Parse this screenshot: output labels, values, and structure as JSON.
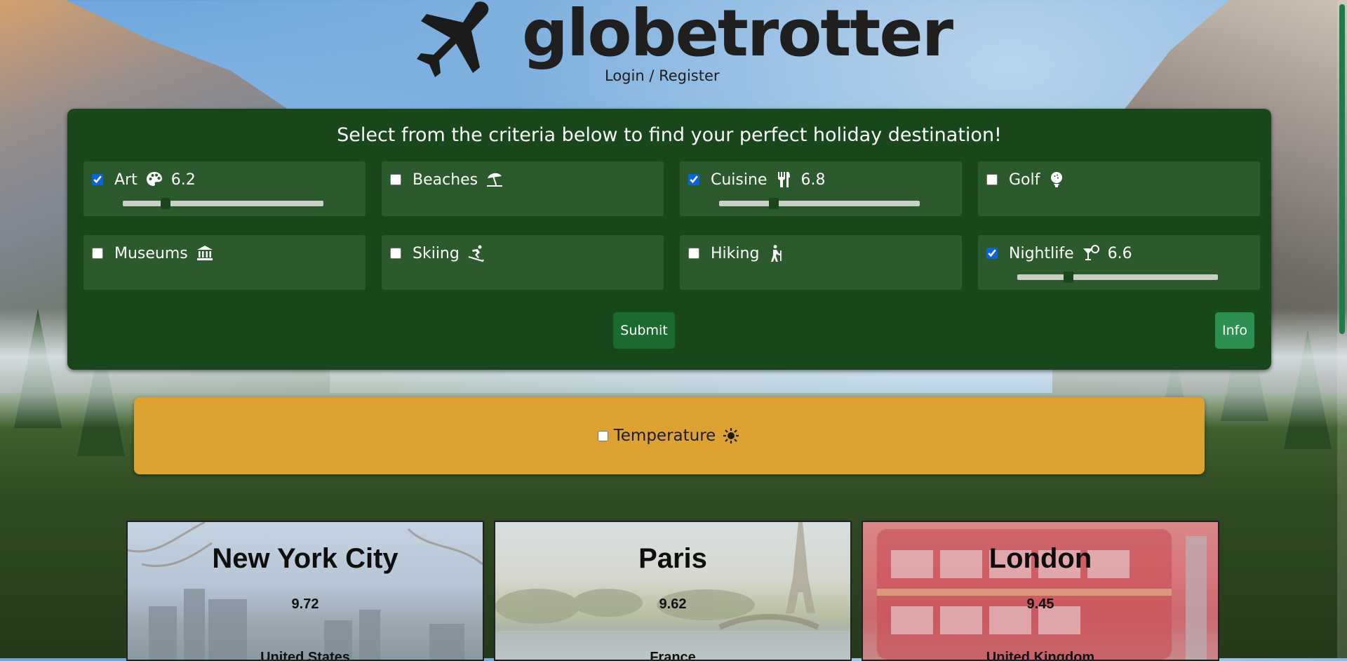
{
  "app": {
    "logo_text": "globetrotter",
    "login_link": "Login / Register"
  },
  "criteria": {
    "heading": "Select from the criteria below to find your perfect holiday destination!",
    "items": [
      {
        "label": "Art",
        "checked": true,
        "value": "6.2",
        "slider_value": 6.2,
        "icon": "palette-icon"
      },
      {
        "label": "Beaches",
        "checked": false,
        "icon": "umbrella-beach-icon"
      },
      {
        "label": "Cuisine",
        "checked": true,
        "value": "6.8",
        "slider_value": 6.8,
        "icon": "utensils-icon"
      },
      {
        "label": "Golf",
        "checked": false,
        "icon": "golf-ball-icon"
      },
      {
        "label": "Museums",
        "checked": false,
        "icon": "landmark-icon"
      },
      {
        "label": "Skiing",
        "checked": false,
        "icon": "skiing-icon"
      },
      {
        "label": "Hiking",
        "checked": false,
        "icon": "hiking-icon"
      },
      {
        "label": "Nightlife",
        "checked": true,
        "value": "6.6",
        "slider_value": 6.6,
        "icon": "cocktail-icon"
      }
    ],
    "submit_label": "Submit",
    "info_label": "Info"
  },
  "temperature": {
    "label": "Temperature",
    "checked": false,
    "icon": "sun-icon"
  },
  "results": [
    {
      "city": "New York City",
      "score": "9.72",
      "country": "United States"
    },
    {
      "city": "Paris",
      "score": "9.62",
      "country": "France"
    },
    {
      "city": "London",
      "score": "9.45",
      "country": "United Kingdom"
    }
  ],
  "colors": {
    "panel": "#17471a",
    "criteria_card": "#2b5a2c",
    "submit": "#1d6a2e",
    "info": "#2e8f52",
    "temperature_panel": "#dea233"
  }
}
